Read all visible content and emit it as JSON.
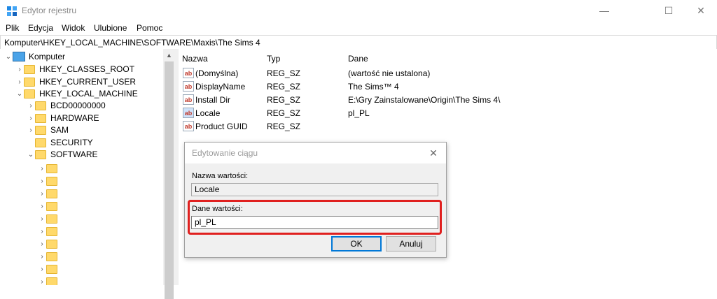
{
  "window": {
    "title": "Edytor rejestru",
    "minimize": "—",
    "maximize": "☐",
    "close": "✕"
  },
  "menu": [
    "Plik",
    "Edycja",
    "Widok",
    "Ulubione",
    "Pomoc"
  ],
  "address": "Komputer\\HKEY_LOCAL_MACHINE\\SOFTWARE\\Maxis\\The Sims 4",
  "tree": {
    "items": [
      {
        "label": "Komputer",
        "chev": "⌄"
      },
      {
        "label": "HKEY_CLASSES_ROOT",
        "chev": "›"
      },
      {
        "label": "HKEY_CURRENT_USER",
        "chev": "›"
      },
      {
        "label": "HKEY_LOCAL_MACHINE",
        "chev": "⌄"
      },
      {
        "label": "BCD00000000",
        "chev": "›"
      },
      {
        "label": "HARDWARE",
        "chev": "›"
      },
      {
        "label": "SAM",
        "chev": "›"
      },
      {
        "label": "SECURITY",
        "chev": ""
      },
      {
        "label": "SOFTWARE",
        "chev": "⌄"
      }
    ],
    "subchev": "›"
  },
  "list": {
    "headers": {
      "name": "Nazwa",
      "type": "Typ",
      "data": "Dane"
    },
    "rows": [
      {
        "name": "(Domyślna)",
        "type": "REG_SZ",
        "data": "(wartość nie ustalona)"
      },
      {
        "name": "DisplayName",
        "type": "REG_SZ",
        "data": "The Sims™ 4"
      },
      {
        "name": "Install Dir",
        "type": "REG_SZ",
        "data": "E:\\Gry Zainstalowane\\Origin\\The Sims 4\\"
      },
      {
        "name": "Locale",
        "type": "REG_SZ",
        "data": "pl_PL"
      },
      {
        "name": "Product GUID",
        "type": "REG_SZ",
        "data": ""
      }
    ],
    "icon_text": "ab"
  },
  "dialog": {
    "title": "Edytowanie ciągu",
    "close": "✕",
    "name_label": "Nazwa wartości:",
    "name_value": "Locale",
    "data_label": "Dane wartości:",
    "data_value": "pl_PL",
    "ok": "OK",
    "cancel": "Anuluj"
  },
  "colors": {
    "highlight": "#e0201f",
    "folder": "#ffd96b",
    "accent": "#0078d7"
  }
}
